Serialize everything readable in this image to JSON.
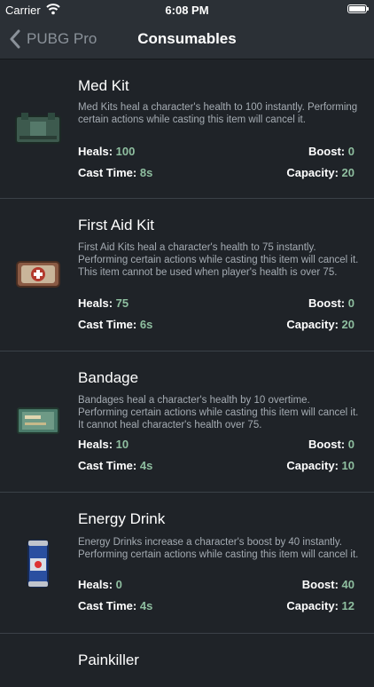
{
  "status_bar": {
    "carrier": "Carrier",
    "time": "6:08 PM"
  },
  "nav": {
    "back_label": "PUBG Pro",
    "title": "Consumables"
  },
  "labels": {
    "heals": "Heals:",
    "boost": "Boost:",
    "cast_time": "Cast Time:",
    "capacity": "Capacity:"
  },
  "items": [
    {
      "name": "Med Kit",
      "description": "Med Kits heal a character's health to 100 instantly. Performing certain actions while casting this item will cancel it.",
      "heals": "100",
      "boost": "0",
      "cast_time": "8s",
      "capacity": "20"
    },
    {
      "name": "First Aid Kit",
      "description": "First Aid Kits heal a character's health to 75 instantly. Performing certain actions while casting this item will cancel it. This item cannot be used when player's health is over 75.",
      "heals": "75",
      "boost": "0",
      "cast_time": "6s",
      "capacity": "20"
    },
    {
      "name": "Bandage",
      "description": "Bandages heal a character's health by 10 overtime. Performing certain actions while casting this item will cancel it. It cannot heal character's health over 75.",
      "heals": "10",
      "boost": "0",
      "cast_time": "4s",
      "capacity": "10"
    },
    {
      "name": "Energy Drink",
      "description": "Energy Drinks increase a character's boost by 40 instantly. Performing certain actions while casting this item will cancel it.",
      "heals": "0",
      "boost": "40",
      "cast_time": "4s",
      "capacity": "12"
    },
    {
      "name": "Painkiller"
    }
  ]
}
